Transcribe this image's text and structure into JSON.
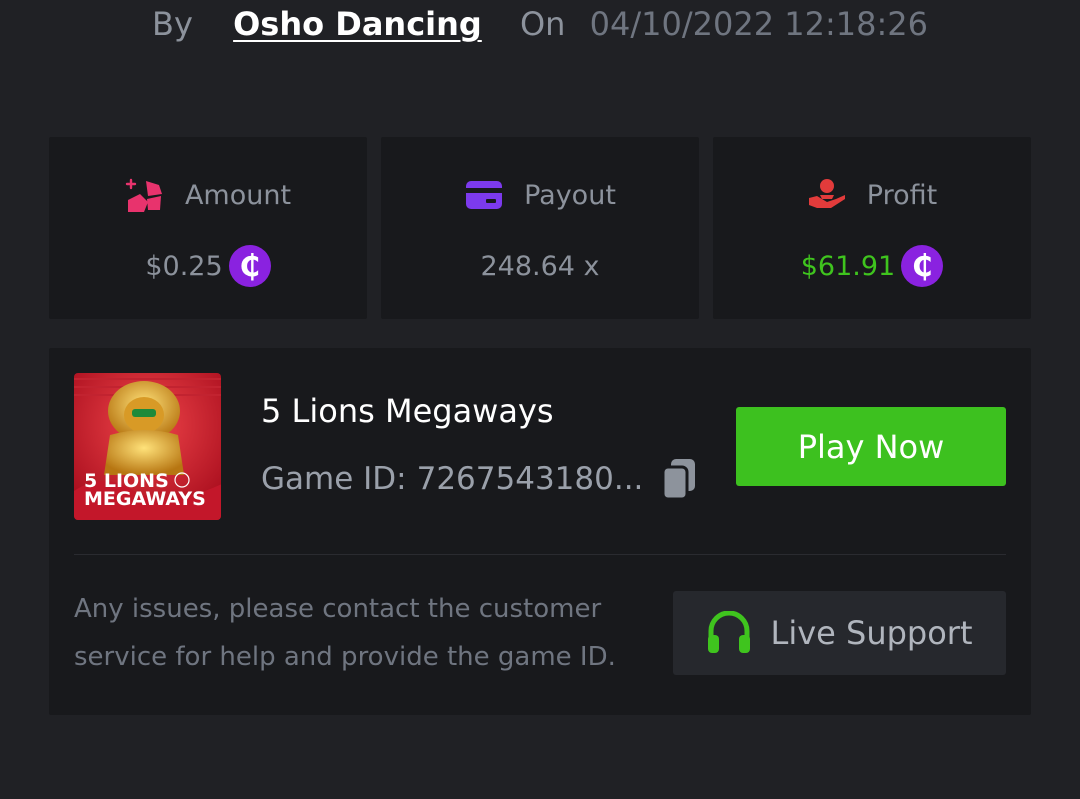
{
  "header": {
    "by_label": "By",
    "author": "Osho Dancing",
    "on_label": "On",
    "timestamp": "04/10/2022 12:18:26"
  },
  "stats": {
    "amount": {
      "label": "Amount",
      "value": "$0.25",
      "icon": "bet-chips-icon",
      "coin_symbol": "₵"
    },
    "payout": {
      "label": "Payout",
      "value": "248.64 x",
      "icon": "credit-card-icon"
    },
    "profit": {
      "label": "Profit",
      "value": "$61.91",
      "icon": "hand-money-icon",
      "coin_symbol": "₵"
    }
  },
  "game": {
    "title": "5 Lions Megaways",
    "id_label": "Game ID:",
    "id_value": "7267543180",
    "id_ellipsis": "...",
    "thumbnail_text_line1": "5 LIONS",
    "thumbnail_text_line2": "MEGAWAYS",
    "play_label": "Play Now"
  },
  "support": {
    "help_text": "Any issues, please contact the customer service for help and provide the game ID.",
    "button_label": "Live Support"
  },
  "colors": {
    "background": "#202125",
    "card": "#18191c",
    "accent_green": "#3dc11f",
    "profit_green": "#3fc41e",
    "coin_purple": "#8a22e0",
    "amount_icon": "#e8336d",
    "payout_icon": "#7c3aed",
    "profit_icon": "#e23b3b"
  }
}
